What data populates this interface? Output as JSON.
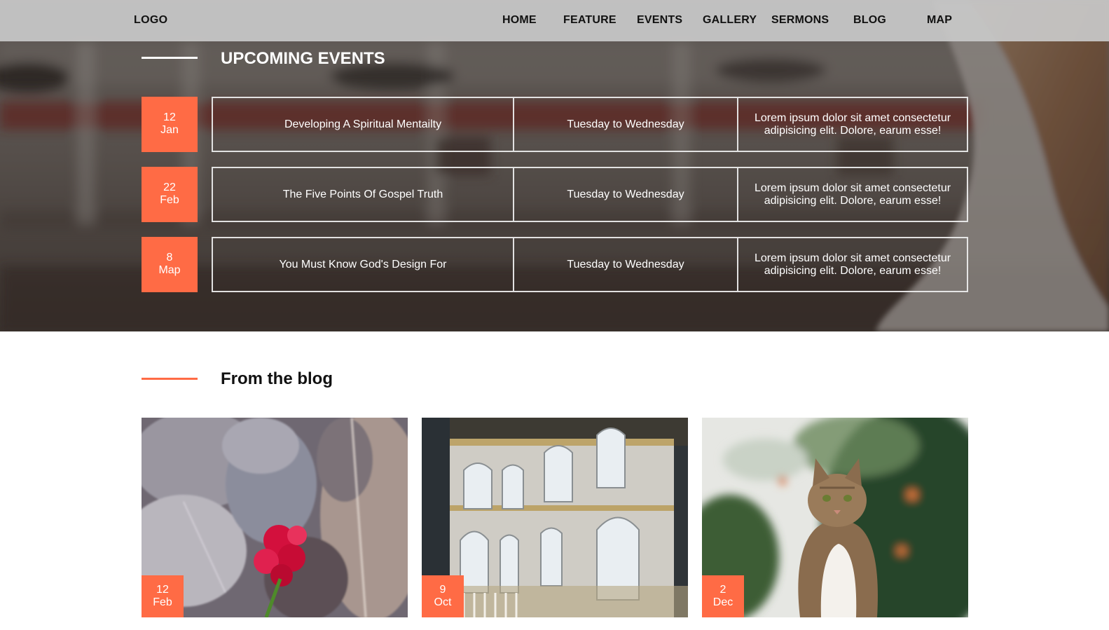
{
  "nav": {
    "logo": "LOGO",
    "items": [
      "HOME",
      "FEATURE",
      "EVENTS",
      "GALLERY",
      "SERMONS",
      "BLOG",
      "MAP"
    ]
  },
  "events_section": {
    "title": "UPCOMING EVENTS",
    "events": [
      {
        "day": "12",
        "month": "Jan",
        "title": "Developing A Spiritual Mentailty",
        "when": "Tuesday to Wednesday",
        "description": "Lorem ipsum dolor sit amet consectetur adipisicing elit. Dolore, earum esse!"
      },
      {
        "day": "22",
        "month": "Feb",
        "title": "The Five Points Of Gospel Truth",
        "when": "Tuesday to Wednesday",
        "description": "Lorem ipsum dolor sit amet consectetur adipisicing elit. Dolore, earum esse!"
      },
      {
        "day": "8",
        "month": "Map",
        "title": "You Must Know God's Design For",
        "when": "Tuesday to Wednesday",
        "description": "Lorem ipsum dolor sit amet consectetur adipisicing elit. Dolore, earum esse!"
      }
    ]
  },
  "blog_section": {
    "title": "From the blog",
    "posts": [
      {
        "day": "12",
        "month": "Feb",
        "image": "leaves-and-red-flower"
      },
      {
        "day": "9",
        "month": "Oct",
        "image": "palace-interior"
      },
      {
        "day": "2",
        "month": "Dec",
        "image": "tabby-cat-outdoors"
      }
    ]
  },
  "colors": {
    "accent": "#ff6b45",
    "navbar": "#c8c8c8",
    "text_dark": "#111111",
    "text_light": "#ffffff"
  }
}
